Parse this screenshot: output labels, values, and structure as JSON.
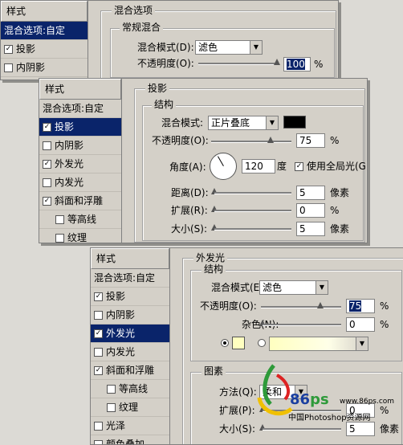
{
  "panel1": {
    "styles_header": "样式",
    "items": [
      {
        "label": "混合选项:自定",
        "checkbox": false,
        "selected": true
      },
      {
        "label": "投影",
        "checkbox": true,
        "checked": true
      },
      {
        "label": "内阴影",
        "checkbox": true,
        "checked": false
      }
    ],
    "group_title": "混合选项",
    "section_title": "常规混合",
    "blend_label": "混合模式(D):",
    "blend_value": "滤色",
    "opacity_label": "不透明度(O):",
    "opacity_value": "100",
    "pct": "%"
  },
  "panel2": {
    "styles_header": "样式",
    "items": [
      {
        "label": "混合选项:自定",
        "checkbox": false
      },
      {
        "label": "投影",
        "checkbox": true,
        "checked": true,
        "selected": true
      },
      {
        "label": "内阴影",
        "checkbox": true,
        "checked": false
      },
      {
        "label": "外发光",
        "checkbox": true,
        "checked": true
      },
      {
        "label": "内发光",
        "checkbox": true,
        "checked": false
      },
      {
        "label": "斜面和浮雕",
        "checkbox": true,
        "checked": true
      },
      {
        "label": "等高线",
        "checkbox": true,
        "checked": false,
        "sub": true
      },
      {
        "label": "纹理",
        "checkbox": true,
        "checked": false,
        "sub": true
      }
    ],
    "group_title": "投影",
    "section_title": "结构",
    "blend_label": "混合模式:",
    "blend_value": "正片叠底",
    "color": "#000000",
    "opacity_label": "不透明度(O):",
    "opacity_value": "75",
    "angle_label": "角度(A):",
    "angle_value": "120",
    "degree": "度",
    "global_light_label": "使用全局光(G)",
    "distance_label": "距离(D):",
    "distance_value": "5",
    "spread_label": "扩展(R):",
    "spread_value": "0",
    "size_label": "大小(S):",
    "size_value": "5",
    "px": "像素",
    "pct": "%"
  },
  "panel3": {
    "styles_header": "样式",
    "items": [
      {
        "label": "混合选项:自定",
        "checkbox": false
      },
      {
        "label": "投影",
        "checkbox": true,
        "checked": true
      },
      {
        "label": "内阴影",
        "checkbox": true,
        "checked": false
      },
      {
        "label": "外发光",
        "checkbox": true,
        "checked": true,
        "selected": true
      },
      {
        "label": "内发光",
        "checkbox": true,
        "checked": false
      },
      {
        "label": "斜面和浮雕",
        "checkbox": true,
        "checked": true
      },
      {
        "label": "等高线",
        "checkbox": true,
        "checked": false,
        "sub": true
      },
      {
        "label": "纹理",
        "checkbox": true,
        "checked": false,
        "sub": true
      },
      {
        "label": "光泽",
        "checkbox": true,
        "checked": false
      },
      {
        "label": "颜色叠加",
        "checkbox": true,
        "checked": false
      }
    ],
    "group_title": "外发光",
    "section_title": "结构",
    "blend_label": "混合模式(E):",
    "blend_value": "滤色",
    "opacity_label": "不透明度(O):",
    "opacity_value": "75",
    "noise_label": "杂色(N):",
    "noise_value": "0",
    "glow_color": "#ffffc0",
    "section2_title": "图素",
    "method_label": "方法(Q):",
    "method_value": "柔和",
    "spread_label": "扩展(P):",
    "spread_value": "0",
    "size_label": "大小(S):",
    "size_value": "5",
    "pct": "%",
    "px": "像素"
  },
  "watermark": {
    "site": "www.86ps.com",
    "brand_num": "86",
    "brand_letters": "ps",
    "cn_name": "中国Photoshop资源网"
  }
}
